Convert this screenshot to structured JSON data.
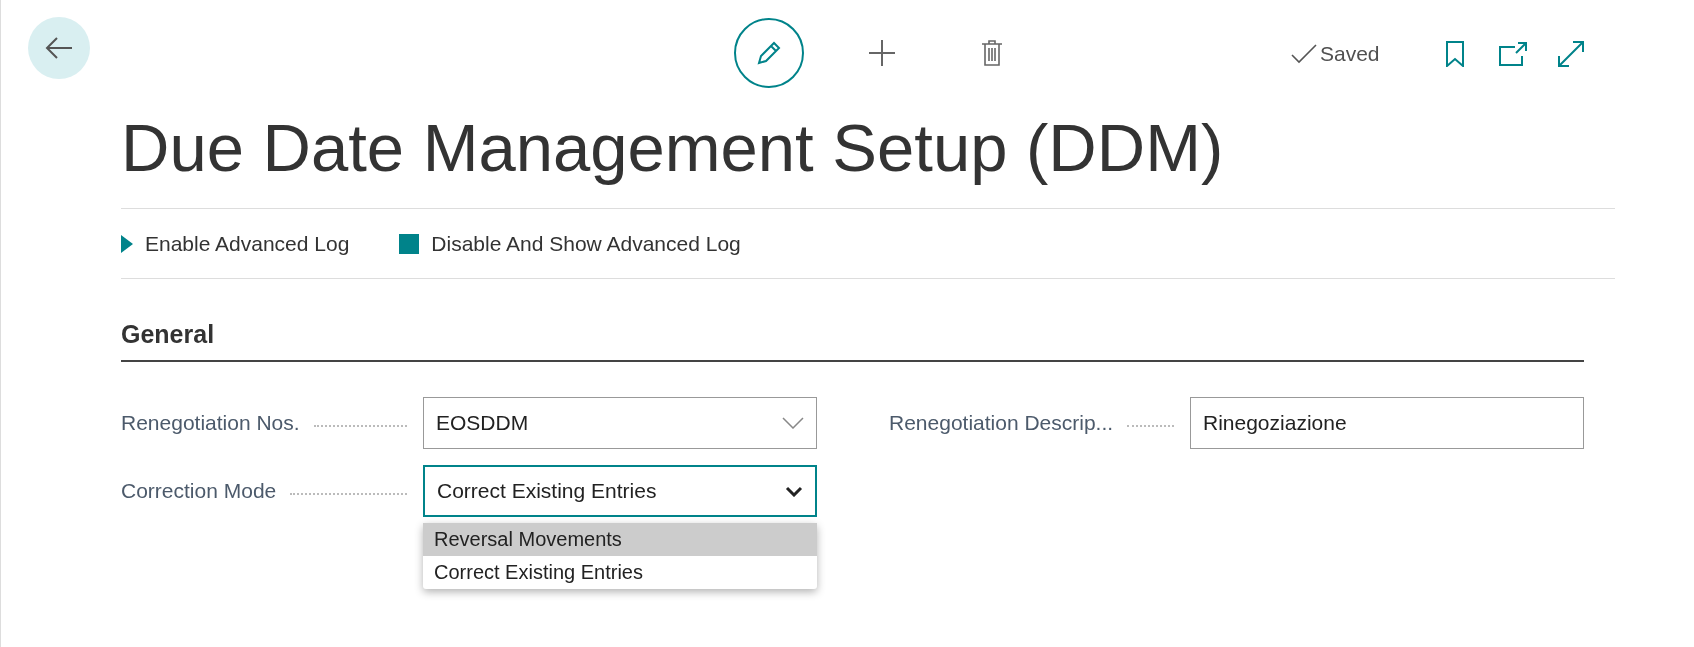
{
  "toolbar": {
    "saved_status": "Saved"
  },
  "title": "Due Date Management Setup (DDM)",
  "actions": [
    {
      "label": "Enable Advanced Log",
      "kind": "play"
    },
    {
      "label": "Disable And Show Advanced Log",
      "kind": "stop"
    }
  ],
  "section": {
    "title": "General",
    "left_fields": [
      {
        "label": "Renegotiation Nos.",
        "kind": "lookup",
        "value": "EOSDDM",
        "focused": false
      },
      {
        "label": "Correction Mode",
        "kind": "select",
        "value": "Correct Existing Entries",
        "focused": true,
        "options": [
          {
            "label": "Reversal Movements",
            "highlighted": true
          },
          {
            "label": "Correct Existing Entries",
            "highlighted": false
          }
        ]
      }
    ],
    "right_fields": [
      {
        "label": "Renegotiation Descrip...",
        "kind": "text",
        "value": "Rinegoziazione",
        "focused": false
      }
    ]
  }
}
